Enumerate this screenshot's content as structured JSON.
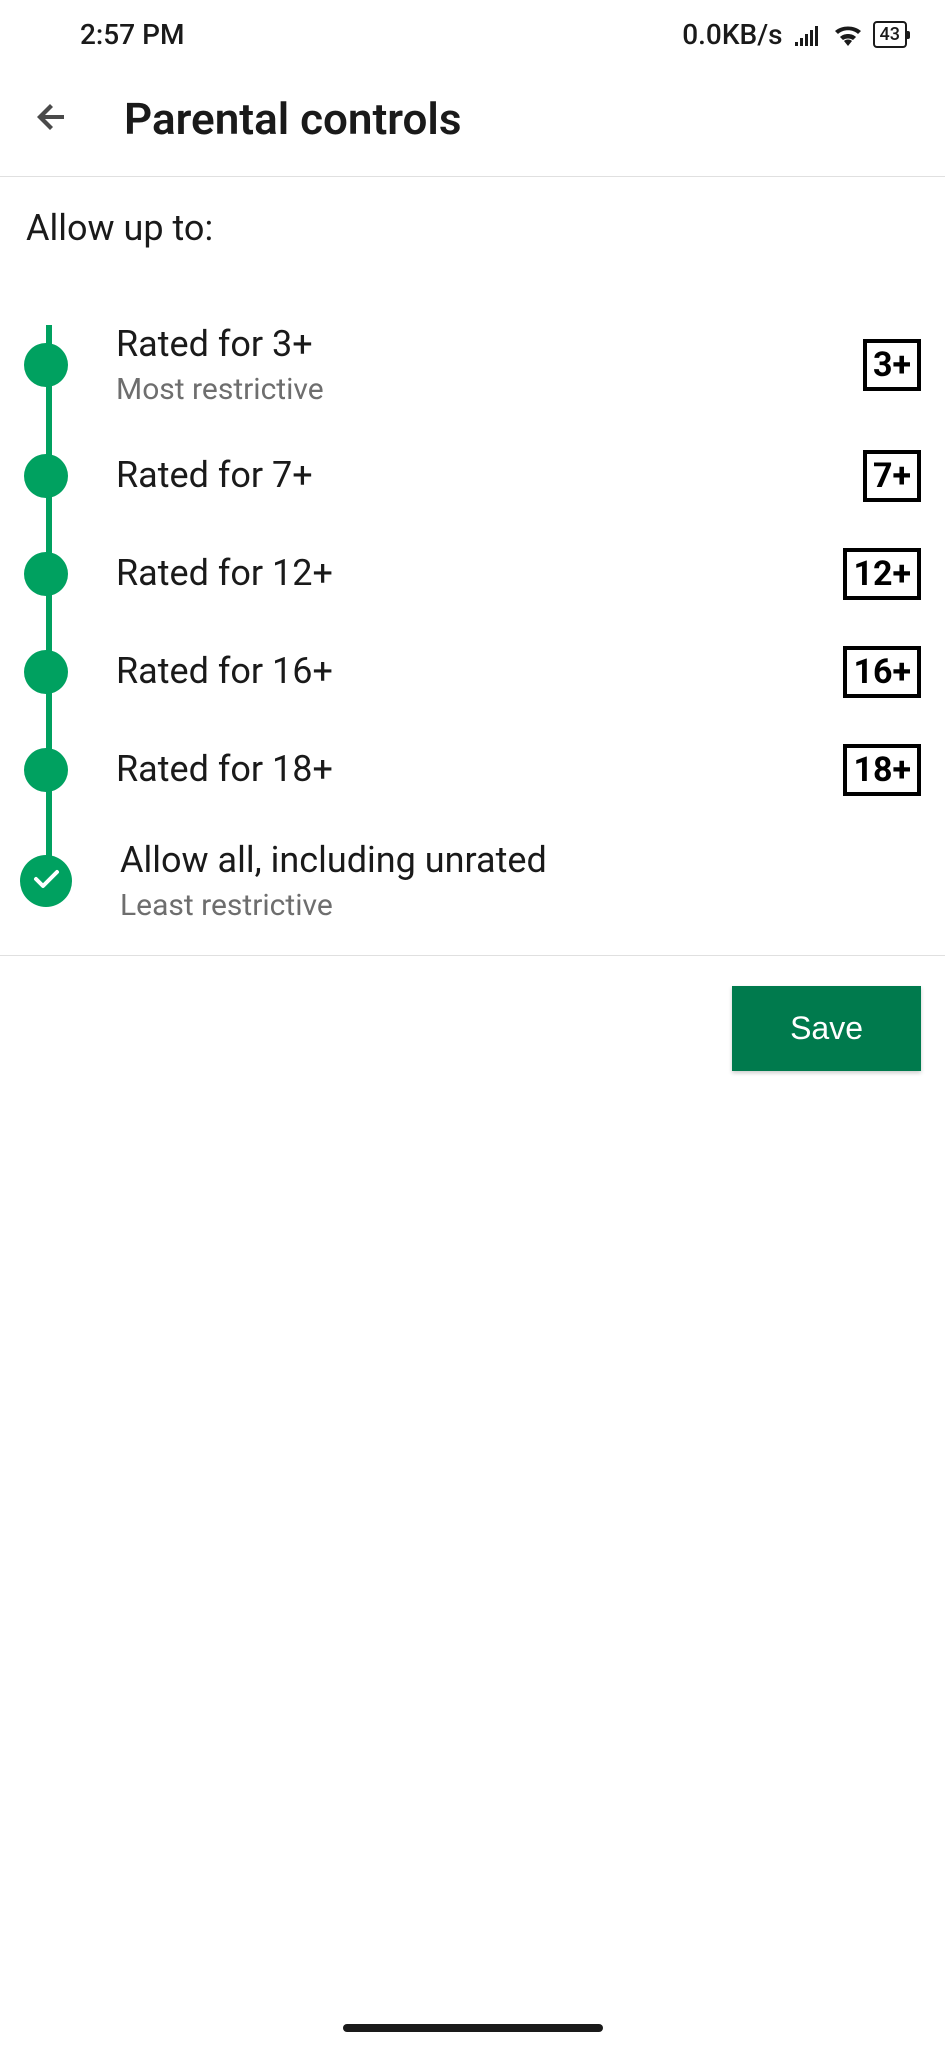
{
  "status_bar": {
    "time": "2:57 PM",
    "data_rate": "0.0KB/s",
    "battery": "43"
  },
  "header": {
    "title": "Parental controls"
  },
  "section_label": "Allow up to:",
  "ratings": [
    {
      "title": "Rated for 3+",
      "subtitle": "Most restrictive",
      "badge": "3+",
      "selected": false
    },
    {
      "title": "Rated for 7+",
      "subtitle": "",
      "badge": "7+",
      "selected": false
    },
    {
      "title": "Rated for 12+",
      "subtitle": "",
      "badge": "12+",
      "selected": false
    },
    {
      "title": "Rated for 16+",
      "subtitle": "",
      "badge": "16+",
      "selected": false
    },
    {
      "title": "Rated for 18+",
      "subtitle": "",
      "badge": "18+",
      "selected": false
    },
    {
      "title": "Allow all, including unrated",
      "subtitle": "Least restrictive",
      "badge": "",
      "selected": true
    }
  ],
  "footer": {
    "save_label": "Save"
  },
  "colors": {
    "accent": "#00a160",
    "button": "#007a4d"
  }
}
